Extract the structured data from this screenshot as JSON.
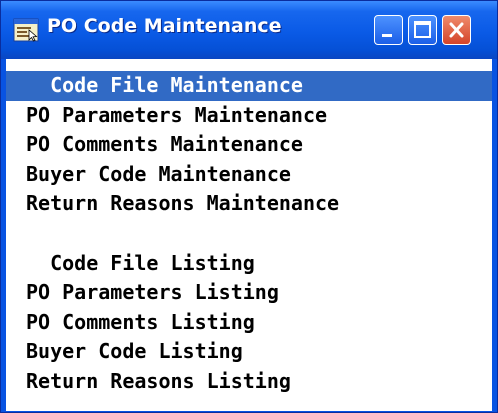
{
  "window": {
    "title": "PO Code Maintenance",
    "accent_color": "#0853e2",
    "selection_color": "#316ac5",
    "icons": {
      "app": "app-window-icon",
      "minimize": "minimize-icon",
      "maximize": "maximize-icon",
      "close": "close-icon"
    }
  },
  "menu": {
    "items": [
      {
        "label": "  Code File Maintenance",
        "type": "heading",
        "selected": true
      },
      {
        "label": "PO Parameters Maintenance",
        "type": "item"
      },
      {
        "label": "PO Comments Maintenance",
        "type": "item"
      },
      {
        "label": "Buyer Code Maintenance",
        "type": "item"
      },
      {
        "label": "Return Reasons Maintenance",
        "type": "item"
      },
      {
        "label": "",
        "type": "blank"
      },
      {
        "label": "  Code File Listing",
        "type": "heading"
      },
      {
        "label": "PO Parameters Listing",
        "type": "item"
      },
      {
        "label": "PO Comments Listing",
        "type": "item"
      },
      {
        "label": "Buyer Code Listing",
        "type": "item"
      },
      {
        "label": "Return Reasons Listing",
        "type": "item"
      }
    ]
  }
}
